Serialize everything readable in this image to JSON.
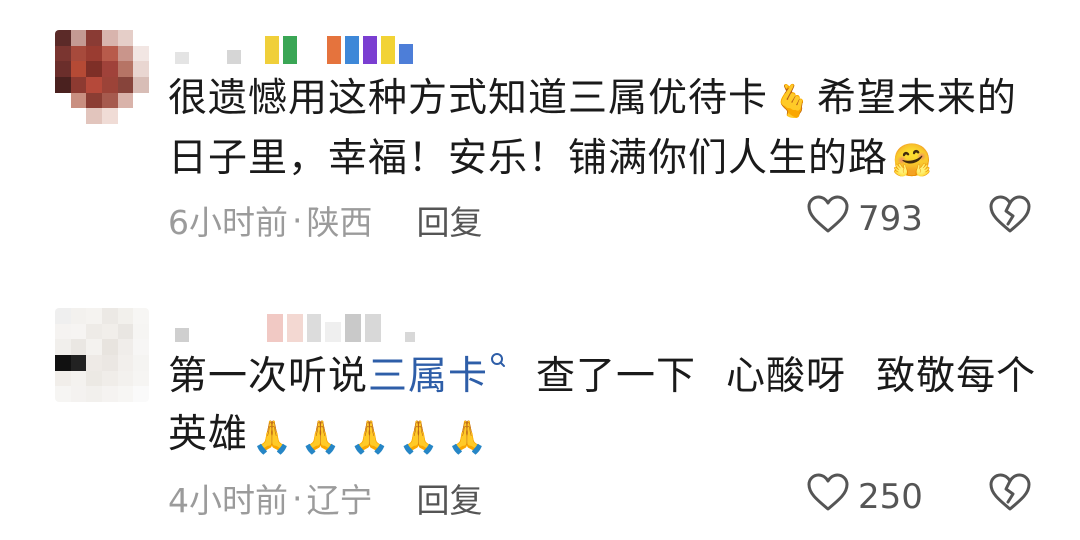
{
  "comments": [
    {
      "text_before": "很遗憾用这种方式知道三属优待卡",
      "emoji_1": "🫰",
      "text_after": "希望未来的日子里，幸福！安乐！铺满你们人生的路",
      "emoji_2": "🤗",
      "time": "6小时前",
      "separator": "·",
      "location": "陕西",
      "reply_label": "回复",
      "like_count": "793"
    },
    {
      "text_before": "第一次听说",
      "link_text": "三属卡",
      "text_mid_1": "查了一下",
      "text_mid_2": "心酸呀",
      "text_after": "致敬每个英雄",
      "emoji": "🙏",
      "time": "4小时前",
      "separator": "·",
      "location": "辽宁",
      "reply_label": "回复",
      "like_count": "250"
    }
  ],
  "icons": {
    "like": "heart-outline-icon",
    "dislike": "broken-heart-icon",
    "search": "search-icon"
  },
  "colors": {
    "text": "#1a1a1a",
    "meta": "#9b9b9b",
    "highlight": "#2e5ea8"
  }
}
